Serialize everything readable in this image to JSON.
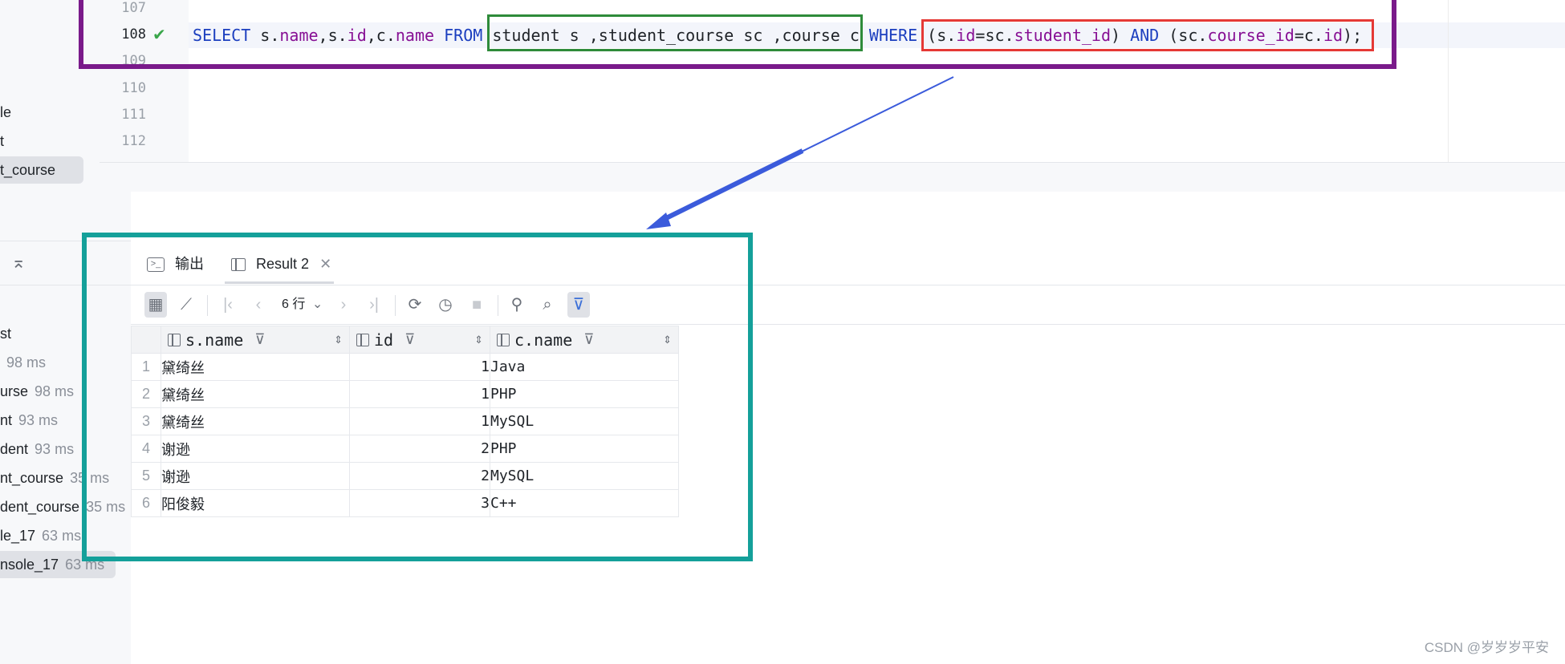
{
  "sidebar": {
    "top_items": [
      {
        "label": "le"
      },
      {
        "label": "t"
      },
      {
        "label": "t_course"
      }
    ],
    "items": [
      {
        "label": "st",
        "time": ""
      },
      {
        "label": "",
        "time": "98 ms"
      },
      {
        "label": "urse",
        "time": "98 ms"
      },
      {
        "label": "nt",
        "time": "93 ms"
      },
      {
        "label": "dent",
        "time": "93 ms"
      },
      {
        "label": "nt_course",
        "time": "35 ms"
      },
      {
        "label": "dent_course",
        "time": "35 ms"
      },
      {
        "label": "le_17",
        "time": "63 ms"
      },
      {
        "label": "nsole_17",
        "time": "63 ms"
      }
    ]
  },
  "editor": {
    "line_numbers": [
      "107",
      "108",
      "109",
      "110",
      "111",
      "112"
    ],
    "current_line": "108",
    "tokens": [
      {
        "t": "SELECT",
        "c": "kw"
      },
      {
        "t": " s.",
        "c": ""
      },
      {
        "t": "name",
        "c": "fld"
      },
      {
        "t": ",s.",
        "c": ""
      },
      {
        "t": "id",
        "c": "fld"
      },
      {
        "t": ",c.",
        "c": ""
      },
      {
        "t": "name",
        "c": "fld"
      },
      {
        "t": " ",
        "c": ""
      },
      {
        "t": "FROM",
        "c": "kw"
      },
      {
        "t": " student s ,student_course sc ,course c ",
        "c": ""
      },
      {
        "t": "WHERE",
        "c": "kw"
      },
      {
        "t": " (s.",
        "c": ""
      },
      {
        "t": "id",
        "c": "fld"
      },
      {
        "t": "=sc.",
        "c": ""
      },
      {
        "t": "student_id",
        "c": "fld"
      },
      {
        "t": ") ",
        "c": ""
      },
      {
        "t": "AND",
        "c": "kw"
      },
      {
        "t": " (sc.",
        "c": ""
      },
      {
        "t": "course_id",
        "c": "fld"
      },
      {
        "t": "=c.",
        "c": ""
      },
      {
        "t": "id",
        "c": "fld"
      },
      {
        "t": ");",
        "c": ""
      }
    ]
  },
  "results": {
    "tabs": [
      {
        "label": "输出",
        "icon": "console-icon"
      },
      {
        "label": "Result 2",
        "icon": "table-icon"
      }
    ],
    "row_count_label": "6 行",
    "columns": [
      "s.name",
      "id",
      "c.name"
    ],
    "rows": [
      {
        "n": "1",
        "name": "黛绮丝",
        "id": "1",
        "course": "Java"
      },
      {
        "n": "2",
        "name": "黛绮丝",
        "id": "1",
        "course": "PHP"
      },
      {
        "n": "3",
        "name": "黛绮丝",
        "id": "1",
        "course": "MySQL"
      },
      {
        "n": "4",
        "name": "谢逊",
        "id": "2",
        "course": "PHP"
      },
      {
        "n": "5",
        "name": "谢逊",
        "id": "2",
        "course": "MySQL"
      },
      {
        "n": "6",
        "name": "阳俊毅",
        "id": "3",
        "course": "C++"
      }
    ]
  },
  "annotation_colors": {
    "query_box": "#7a1a8a",
    "from_box": "#2e8b3a",
    "where_box": "#e53935",
    "result_box": "#14a09a",
    "arrow": "#3b5bdb"
  },
  "watermark": "CSDN @岁岁岁平安"
}
